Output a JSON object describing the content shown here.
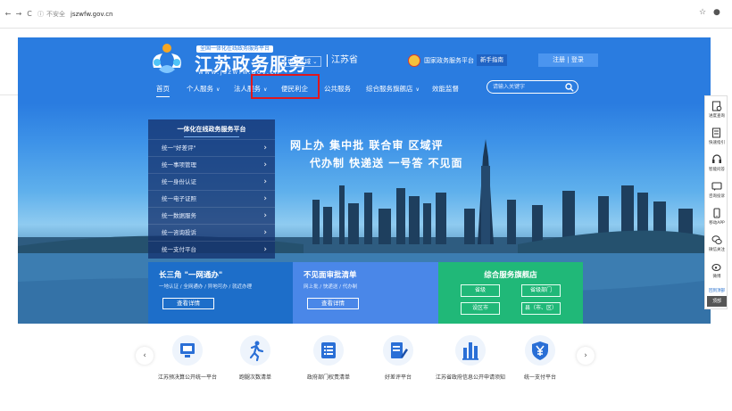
{
  "browser": {
    "back": "←",
    "forward": "→",
    "reload": "C",
    "security": "不安全",
    "url": "jszwfw.gov.cn"
  },
  "header": {
    "slogan": "全国一体化在线政务服务平台",
    "site_title": "江苏政务服务",
    "site_url": "www.jszwfw.gov.cn",
    "region_button": "切换区域",
    "region_name": "江苏省",
    "national_platform": "国家政务服务平台",
    "newbie_button": "新手指南",
    "login": "注册 | 登录"
  },
  "menu": [
    {
      "label": "首页",
      "has_caret": false
    },
    {
      "label": "个人服务",
      "has_caret": true
    },
    {
      "label": "法人服务",
      "has_caret": true
    },
    {
      "label": "便民利企",
      "has_caret": false
    },
    {
      "label": "公共服务",
      "has_caret": false
    },
    {
      "label": "综合服务旗舰店",
      "has_caret": true
    },
    {
      "label": "效能监督",
      "has_caret": false
    }
  ],
  "search": {
    "placeholder": "请输入关键字"
  },
  "banner": {
    "slogan_line1": "网上办  集中批  联合审  区域评",
    "slogan_line2": "代办制  快递送  一号答  不见面"
  },
  "side_panel": {
    "title": "一体化在线政务服务平台",
    "items": [
      "统一\"好差评\"",
      "统一事项管理",
      "统一身份认证",
      "统一电子证照",
      "统一数据服务",
      "统一咨询投诉",
      "统一支付平台"
    ]
  },
  "cards": {
    "yangtze": {
      "title": "长三角 \"一网通办\"",
      "subtitle": "一地认证 / 全网通办 / 异地可办 / 就近办理",
      "button": "查看详情"
    },
    "no_meet": {
      "title": "不见面审批清单",
      "subtitle": "网上批 / 快递送 / 代办制",
      "button": "查看详情"
    },
    "flagship": {
      "title": "综合服务旗舰店",
      "buttons": [
        "省级",
        "省级部门",
        "设区市",
        "县（市、区）"
      ]
    }
  },
  "float_bar": {
    "items": [
      "进度查询",
      "快速指引",
      "智能问答",
      "咨询投诉",
      "移动APP",
      "微信关注",
      "微博"
    ],
    "link": "回到顶部",
    "top": "顶部"
  },
  "services": [
    "江苏预决算公开统一平台",
    "跑腿次数清单",
    "政府部门权责清单",
    "好差评平台",
    "江苏省政府信息公开申请须知",
    "统一支付平台"
  ],
  "colors": {
    "header_blue": "#2a7ce0",
    "highlight_red": "#e0171d",
    "card_blue": "#1d6ec9",
    "card_lightblue": "#4a87e8",
    "card_green": "#20b878"
  }
}
